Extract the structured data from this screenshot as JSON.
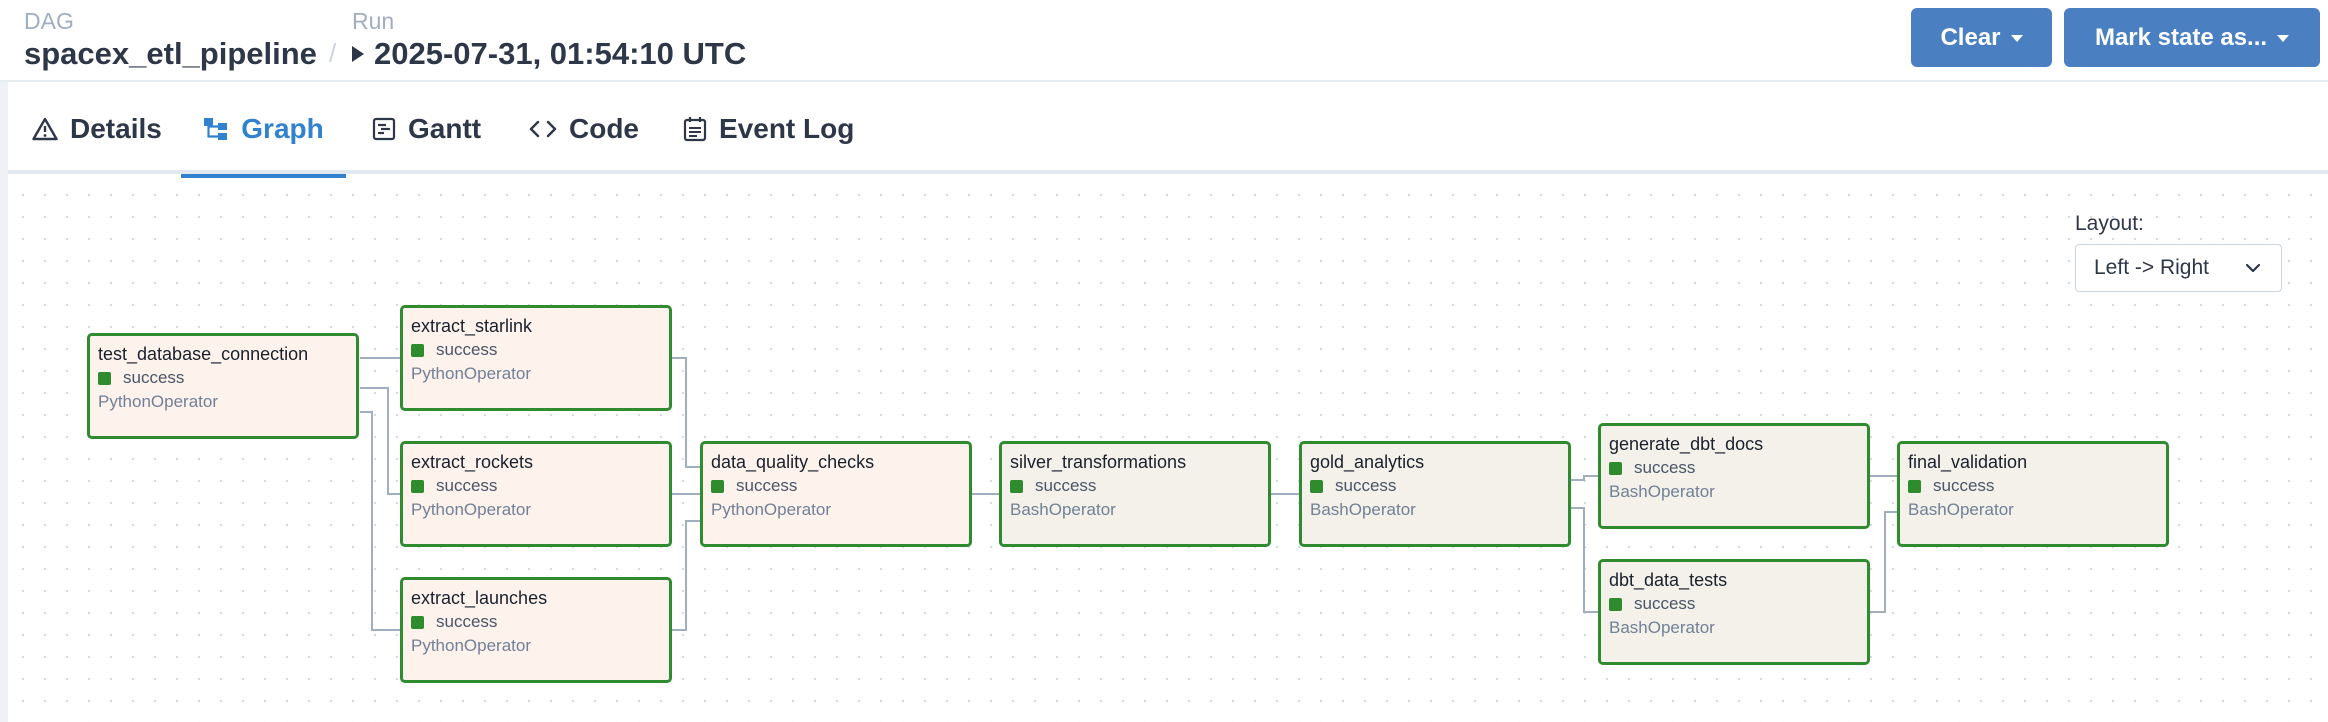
{
  "breadcrumb": {
    "dag_label": "DAG",
    "dag_name": "spacex_etl_pipeline",
    "separator": "/",
    "run_label": "Run",
    "run_value": "2025-07-31, 01:54:10 UTC"
  },
  "actions": {
    "clear_label": "Clear",
    "mark_label": "Mark state as..."
  },
  "tabs": [
    {
      "label": "Details"
    },
    {
      "label": "Graph"
    },
    {
      "label": "Gantt"
    },
    {
      "label": "Code"
    },
    {
      "label": "Event Log"
    }
  ],
  "layout": {
    "label": "Layout:",
    "value": "Left -> Right"
  },
  "colors": {
    "accent": "#3182ce",
    "button": "#4a7fc1",
    "success": "#2e8b2e"
  },
  "nodes": {
    "test_database_connection": {
      "name": "test_database_connection",
      "status": "success",
      "operator": "PythonOperator"
    },
    "extract_starlink": {
      "name": "extract_starlink",
      "status": "success",
      "operator": "PythonOperator"
    },
    "extract_rockets": {
      "name": "extract_rockets",
      "status": "success",
      "operator": "PythonOperator"
    },
    "extract_launches": {
      "name": "extract_launches",
      "status": "success",
      "operator": "PythonOperator"
    },
    "data_quality_checks": {
      "name": "data_quality_checks",
      "status": "success",
      "operator": "PythonOperator"
    },
    "silver_transformations": {
      "name": "silver_transformations",
      "status": "success",
      "operator": "BashOperator"
    },
    "gold_analytics": {
      "name": "gold_analytics",
      "status": "success",
      "operator": "BashOperator"
    },
    "generate_dbt_docs": {
      "name": "generate_dbt_docs",
      "status": "success",
      "operator": "BashOperator"
    },
    "dbt_data_tests": {
      "name": "dbt_data_tests",
      "status": "success",
      "operator": "BashOperator"
    },
    "final_validation": {
      "name": "final_validation",
      "status": "success",
      "operator": "BashOperator"
    }
  }
}
